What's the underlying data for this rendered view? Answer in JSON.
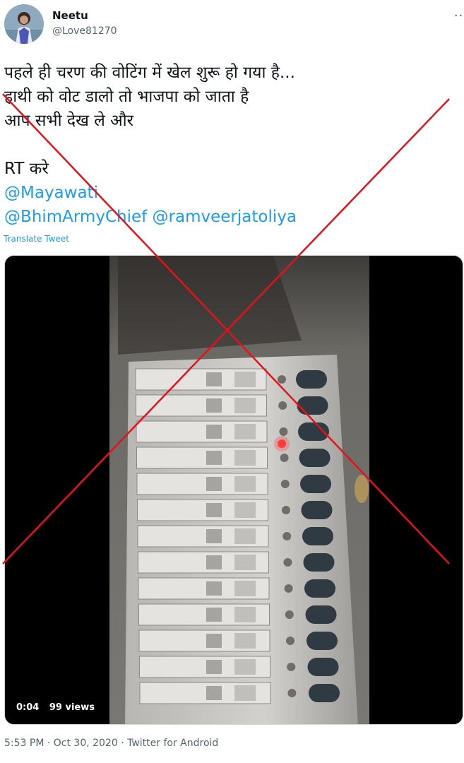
{
  "user": {
    "name": "Neetu",
    "handle": "@Love81270"
  },
  "tweet": {
    "lines": [
      "पहले ही चरण की वोटिंग में खेल शुरू हो गया है...",
      "हाथी को वोट डालो तो भाजपा को जाता है",
      "आप सभी देख ले और",
      "",
      "RT करे"
    ],
    "mentions": [
      "@Mayawati",
      "@BhimArmyChief",
      "@ramveerjatoliya"
    ],
    "translate_label": "Translate Tweet"
  },
  "video": {
    "duration": "0:04",
    "views": "99 views"
  },
  "meta": {
    "timestamp": "5:53 PM · Oct 30, 2020 · Twitter for Android"
  },
  "colors": {
    "accent": "#1d9bf0",
    "cross": "#e3121b"
  },
  "icons": {
    "more": "more-icon"
  }
}
